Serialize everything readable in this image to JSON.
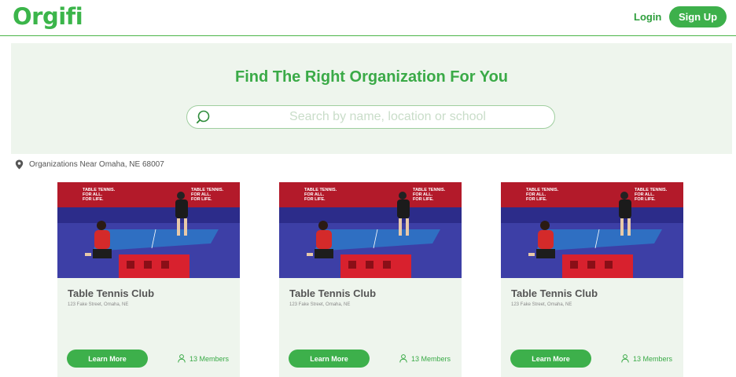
{
  "header": {
    "logo": "Orgifi",
    "login_label": "Login",
    "signup_label": "Sign Up"
  },
  "hero": {
    "title": "Find The Right Organization For You",
    "search_placeholder": "Search by name, location or school"
  },
  "location": {
    "text": "Organizations Near Omaha, NE 68007"
  },
  "cards": [
    {
      "banner_text": "TABLE TENNIS. FOR ALL. FOR LIFE.",
      "title": "Table Tennis Club",
      "address": "123 Fake Street, Omaha, NE",
      "button_label": "Learn More",
      "members": "13 Members"
    },
    {
      "banner_text": "TABLE TENNIS. FOR ALL. FOR LIFE.",
      "title": "Table Tennis Club",
      "address": "123 Fake Street, Omaha, NE",
      "button_label": "Learn More",
      "members": "13 Members"
    },
    {
      "banner_text": "TABLE TENNIS. FOR ALL. FOR LIFE.",
      "title": "Table Tennis Club",
      "address": "123 Fake Street, Omaha, NE",
      "button_label": "Learn More",
      "members": "13 Members"
    }
  ],
  "colors": {
    "brand_green": "#3db04b",
    "hero_bg": "#eef5ed"
  },
  "icons": [
    "search-icon",
    "map-pin-icon",
    "person-icon"
  ]
}
